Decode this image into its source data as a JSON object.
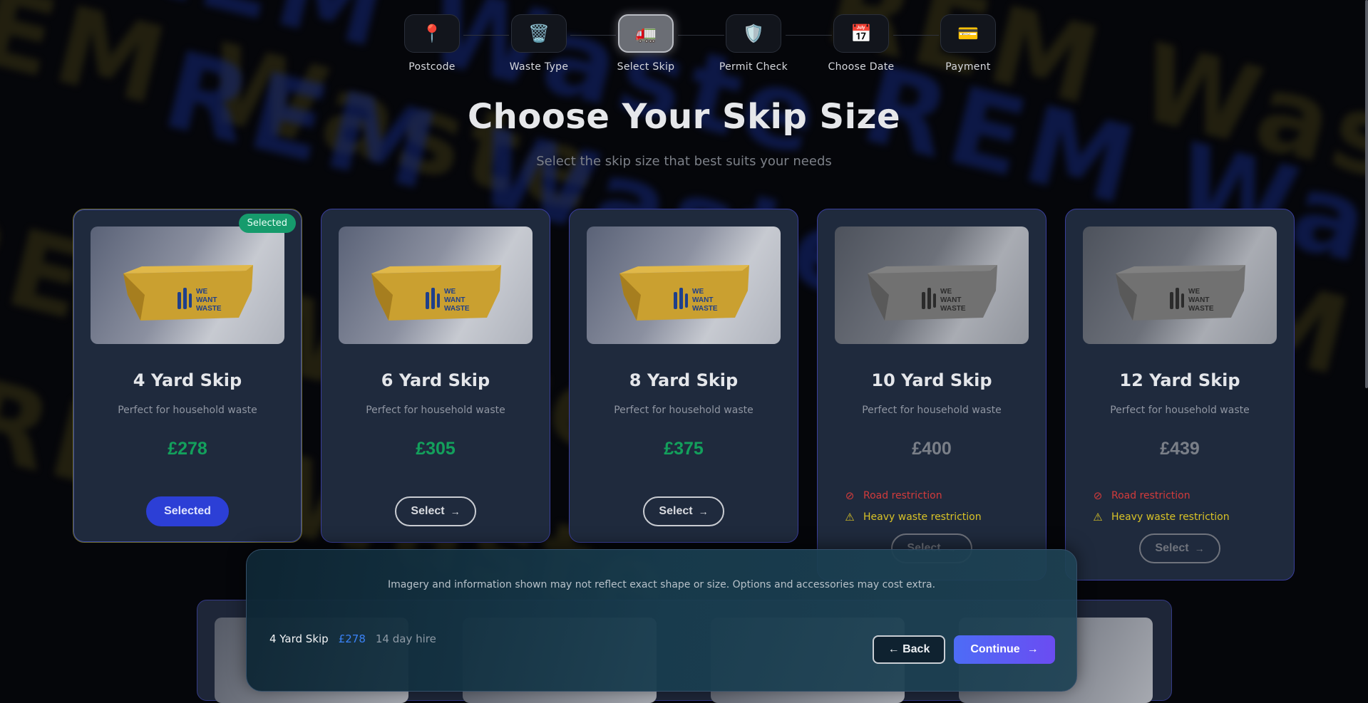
{
  "stepper": {
    "steps": [
      {
        "label": "Postcode",
        "icon": "📍",
        "icon_name": "map-pin-icon",
        "state": "done"
      },
      {
        "label": "Waste Type",
        "icon": "🗑️",
        "icon_name": "trash-icon",
        "state": "done"
      },
      {
        "label": "Select Skip",
        "icon": "🚛",
        "icon_name": "truck-icon",
        "state": "current"
      },
      {
        "label": "Permit Check",
        "icon": "🛡️",
        "icon_name": "shield-icon",
        "state": "upcoming"
      },
      {
        "label": "Choose Date",
        "icon": "📅",
        "icon_name": "calendar-icon",
        "state": "upcoming"
      },
      {
        "label": "Payment",
        "icon": "💳",
        "icon_name": "credit-card-icon",
        "state": "upcoming"
      }
    ]
  },
  "header": {
    "title": "Choose Your Skip Size",
    "subtitle": "Select the skip size that best suits your needs"
  },
  "skip_brand": {
    "line1": "WE",
    "line2": "WANT",
    "line3": "WASTE"
  },
  "cards": [
    {
      "title": "4 Yard Skip",
      "description": "Perfect for household waste",
      "price": "£278",
      "selected": true,
      "badge": "Selected",
      "button": "Selected",
      "restrictions": []
    },
    {
      "title": "6 Yard Skip",
      "description": "Perfect for household waste",
      "price": "£305",
      "selected": false,
      "button": "Select",
      "restrictions": []
    },
    {
      "title": "8 Yard Skip",
      "description": "Perfect for household waste",
      "price": "£375",
      "selected": false,
      "button": "Select",
      "restrictions": []
    },
    {
      "title": "10 Yard Skip",
      "description": "Perfect for household waste",
      "price": "£400",
      "selected": false,
      "button": "Select",
      "restrictions": [
        "Road restriction",
        "Heavy waste restriction"
      ]
    },
    {
      "title": "12 Yard Skip",
      "description": "Perfect for household waste",
      "price": "£439",
      "selected": false,
      "button": "Select",
      "restrictions": [
        "Road restriction",
        "Heavy waste restriction"
      ]
    }
  ],
  "arrow": "→",
  "bottom_panel": {
    "disclaimer": "Imagery and information shown may not reflect exact shape or size. Options and accessories may cost extra.",
    "summary": {
      "name": "4 Yard Skip",
      "price": "£278",
      "period": "14 day hire"
    },
    "back_label": "← Back",
    "continue_label": "Continue",
    "continue_arrow": "→"
  },
  "background_watermark": "REM Waste",
  "colors": {
    "price_green": "#13a05c",
    "selected_badge": "#169b6c",
    "selected_button": "#2c3fd6",
    "road_restriction": "#d23b3b",
    "heavy_restriction": "#d8c227",
    "summary_price": "#3a82f6"
  }
}
